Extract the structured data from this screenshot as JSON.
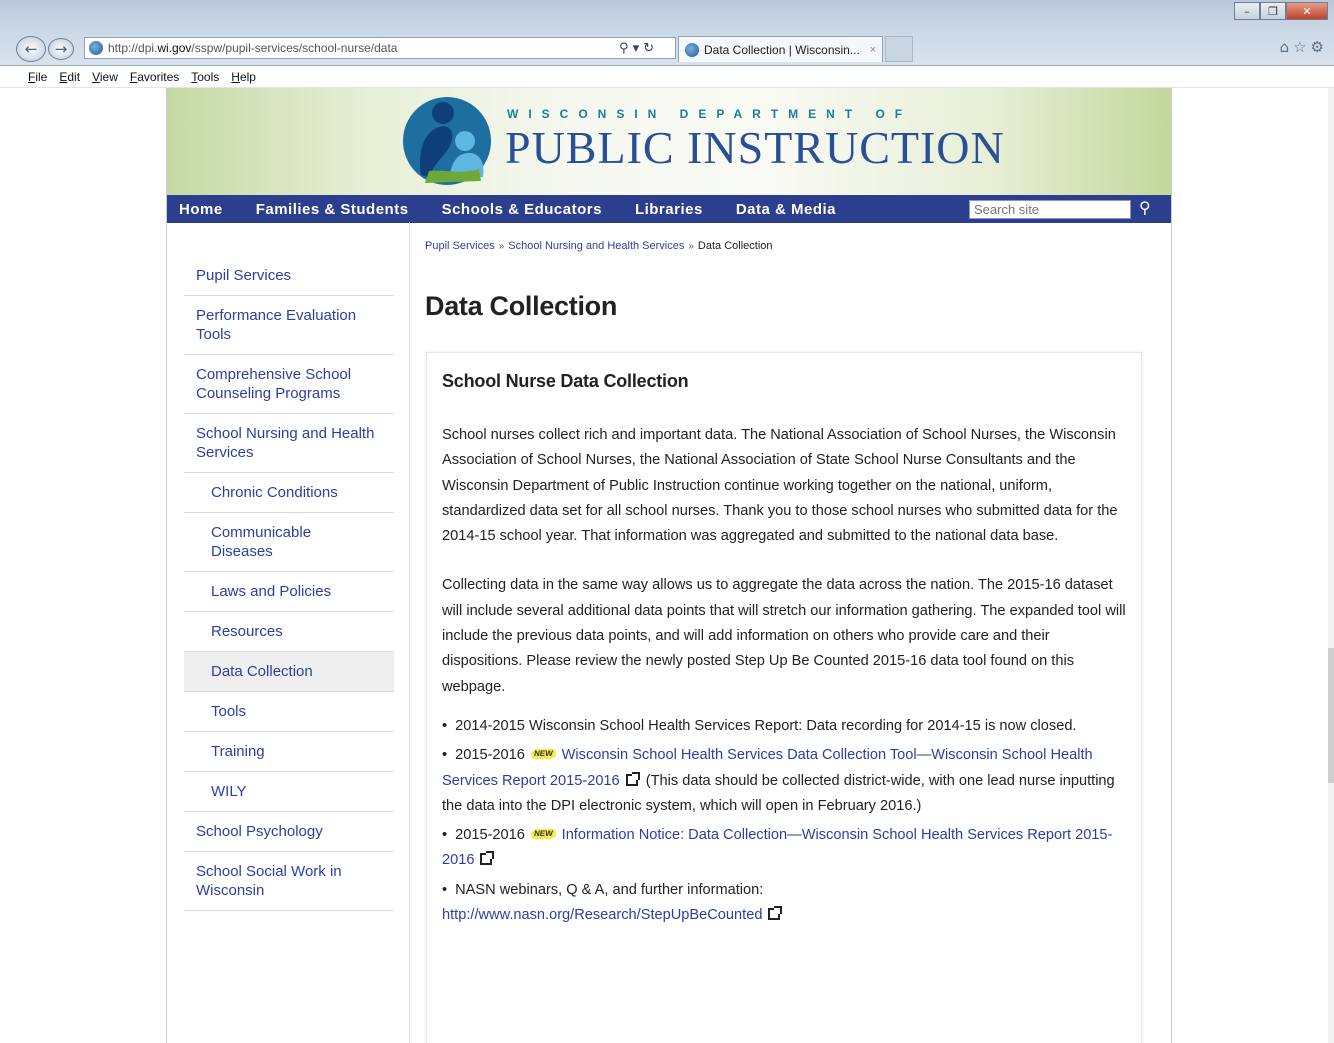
{
  "browser": {
    "url_prefix": "http://dpi.",
    "url_domain": "wi.gov",
    "url_path": "/sspw/pupil-services/school-nurse/data",
    "address_tools": "⚲ ▾ ↻",
    "tab_title": "Data Collection | Wisconsin...",
    "tab_close": "×",
    "back_icon": "←",
    "forward_icon": "→",
    "right_icons": "⌂☆⚙",
    "window_controls": [
      "–",
      "❐",
      "✕"
    ]
  },
  "menu": [
    "File",
    "Edit",
    "View",
    "Favorites",
    "Tools",
    "Help"
  ],
  "header": {
    "logo_top": "WISCONSIN DEPARTMENT OF",
    "logo_main": "PUBLIC INSTRUCTION"
  },
  "nav": {
    "items": [
      "Home",
      "Families & Students",
      "Schools & Educators",
      "Libraries",
      "Data & Media"
    ],
    "search_placeholder": "Search site",
    "search_icon": "⚲"
  },
  "sidebar": {
    "items": [
      {
        "label": "Pupil Services",
        "sub": false
      },
      {
        "label": "Performance Evaluation Tools",
        "sub": false
      },
      {
        "label": "Comprehensive School Counseling Programs",
        "sub": false
      },
      {
        "label": "School Nursing and Health Services",
        "sub": false
      },
      {
        "label": "Chronic Conditions",
        "sub": true
      },
      {
        "label": "Communicable Diseases",
        "sub": true
      },
      {
        "label": "Laws and Policies",
        "sub": true
      },
      {
        "label": "Resources",
        "sub": true
      },
      {
        "label": "Data Collection",
        "sub": true,
        "active": true
      },
      {
        "label": "Tools",
        "sub": true
      },
      {
        "label": "Training",
        "sub": true
      },
      {
        "label": "WILY",
        "sub": true
      },
      {
        "label": "School Psychology",
        "sub": false
      },
      {
        "label": "School Social Work in Wisconsin",
        "sub": false
      }
    ]
  },
  "breadcrumb": {
    "items": [
      "Pupil Services",
      "School Nursing and Health Services"
    ],
    "current": "Data Collection",
    "separator": "»"
  },
  "main": {
    "title": "Data Collection",
    "box_title": "School Nurse Data Collection",
    "para1": "School nurses collect rich and important data. The National Association of School Nurses, the Wisconsin Association of School Nurses, the National Association of State School Nurse Consultants and the Wisconsin Department of Public Instruction continue working together on the national, uniform, standardized data set for all school nurses. Thank you to those school nurses who submitted data for the 2014-15 school year. That information was aggregated and submitted to the national data base.",
    "para2": "Collecting data in the same way allows us to aggregate the data across the nation. The 2015-16 dataset will include several additional data points that will stretch our information gathering. The expanded tool will include the previous data points, and will add information on others who provide care and their dispositions. Please review the newly posted Step Up Be Counted 2015-16 data tool found on this webpage.",
    "bullets": {
      "b1_text": "2014-2015 Wisconsin School Health Services Report: Data recording for 2014-15 is now closed.",
      "b2_year": "2015-2016",
      "b2_link": "Wisconsin School Health Services Data Collection Tool—Wisconsin School Health Services Report 2015-2016",
      "b2_note": "(This data should be collected district-wide, with one lead nurse inputting the data into the DPI electronic system, which will open in February 2016.)",
      "b3_year": "2015-2016",
      "b3_link": "Information Notice: Data Collection—Wisconsin School Health Services Report 2015-2016",
      "b4_text": "NASN webinars, Q & A, and further information:",
      "b4_link": "http://www.nasn.org/Research/StepUpBeCounted",
      "new_badge": "NEW",
      "bullet_char": "•"
    }
  }
}
